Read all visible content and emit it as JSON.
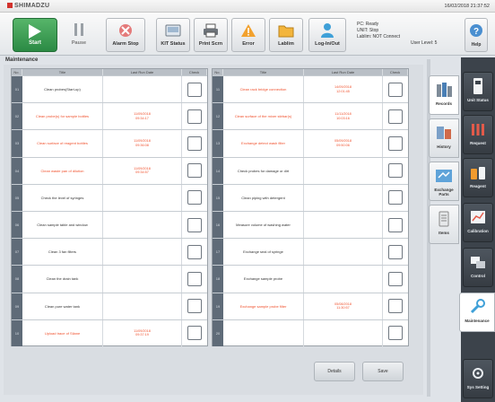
{
  "header": {
    "brand": "SHIMADZU",
    "datetime": "16/02/2018 21:37:52"
  },
  "toolbar": {
    "start": "Start",
    "pause": "Pause",
    "alarm_stop": "Alarm Stop",
    "kit_status": "KIT Status",
    "print_scrn": "Print Scrn",
    "error": "Error",
    "lablim": "Lablim",
    "log_in_out": "Log-In/Out",
    "help": "Help"
  },
  "status": {
    "line1": "PC: Ready",
    "line2": "UNIT: Stop",
    "line3": "Lablim: NOT Connect",
    "user_level": "User Level: 5"
  },
  "panel": {
    "title": "Maintenance",
    "headers": {
      "no": "No.",
      "title": "Title",
      "last_run": "Last Run Date",
      "check": "Check"
    },
    "left_rows": [
      {
        "no": "01",
        "title": "Clean probes(Start-up)",
        "date": "",
        "red": false
      },
      {
        "no": "02",
        "title": "Clean probe(s) for sample bottles",
        "date": "11/09/2018\n09:34:17",
        "red": true
      },
      {
        "no": "03",
        "title": "Clean surface of reagent bottles",
        "date": "11/09/2018\n09:36:08",
        "red": true
      },
      {
        "no": "04",
        "title": "Clean waste pan of dilution",
        "date": "11/09/2018\n09:34:57",
        "red": true
      },
      {
        "no": "05",
        "title": "Check the level of syringes",
        "date": "",
        "red": false
      },
      {
        "no": "06",
        "title": "Clean sample table and window",
        "date": "",
        "red": false
      },
      {
        "no": "07",
        "title": "Clean 3 fan filters",
        "date": "",
        "red": false
      },
      {
        "no": "08",
        "title": "Clean the drain tank",
        "date": "",
        "red": false
      },
      {
        "no": "09",
        "title": "Clean pure water tank",
        "date": "",
        "red": false
      },
      {
        "no": "10",
        "title": "Upload trace of Silane",
        "date": "11/09/2018\n09:37:19",
        "red": true
      }
    ],
    "right_rows": [
      {
        "no": "11",
        "title": "Clean rack bridge connection",
        "date": "14/09/2018\n12:01:45",
        "red": true
      },
      {
        "no": "12",
        "title": "Clean surface of the mixer stirbar(s)",
        "date": "11/11/2018\n10:03:16",
        "red": true
      },
      {
        "no": "13",
        "title": "Exchange detect wash filter",
        "date": "05/09/2018\n09:50:06",
        "red": true
      },
      {
        "no": "14",
        "title": "Check probes for damage or dirt",
        "date": "",
        "red": false
      },
      {
        "no": "15",
        "title": "Clean piping with detergent",
        "date": "",
        "red": false
      },
      {
        "no": "16",
        "title": "Measure volume of washing water",
        "date": "",
        "red": false
      },
      {
        "no": "17",
        "title": "Exchange seal of syringe",
        "date": "",
        "red": false
      },
      {
        "no": "18",
        "title": "Exchange sample probe",
        "date": "",
        "red": false
      },
      {
        "no": "19",
        "title": "Exchange sample probe filter",
        "date": "05/08/2018\n11:30:57",
        "red": true
      },
      {
        "no": "20",
        "title": "",
        "date": "",
        "red": false
      }
    ],
    "details_btn": "Details",
    "save_btn": "Save"
  },
  "side_tabs": [
    "Records",
    "History",
    "Exchange Parts",
    "Items"
  ],
  "rail_tabs": [
    "Unit Status",
    "Request",
    "Reagent",
    "Calibration",
    "Control",
    "Maintenance",
    "Sys Setting"
  ],
  "colors": {
    "accent_red": "#f0522e",
    "start_green": "#2b8a44",
    "rail": "#3c434b"
  }
}
